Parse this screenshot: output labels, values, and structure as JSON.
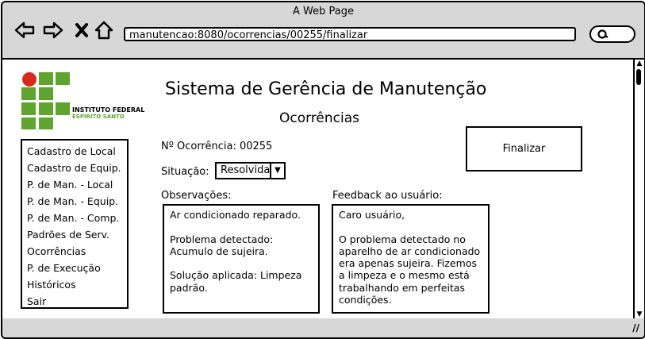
{
  "browser": {
    "title": "A Web Page",
    "url": "manutencao:8080/ocorrencias/00255/finalizar"
  },
  "logo": {
    "line1": "INSTITUTO FEDERAL",
    "line2": "ESPÍRITO SANTO",
    "colors": {
      "green": "#5ea42f",
      "red": "#d9281c"
    }
  },
  "header": {
    "app_title": "Sistema de Gerência de Manutenção",
    "section_title": "Ocorrências"
  },
  "sidebar": {
    "items": [
      {
        "label": "Cadastro de Local"
      },
      {
        "label": "Cadastro de Equip."
      },
      {
        "label": "P. de Man. - Local"
      },
      {
        "label": "P. de Man. - Equip."
      },
      {
        "label": "P. de Man. - Comp."
      },
      {
        "label": "Padrões de Serv."
      },
      {
        "label": "Ocorrências"
      },
      {
        "label": "P. de Execução"
      },
      {
        "label": "Históricos"
      },
      {
        "label": "Sair"
      }
    ]
  },
  "form": {
    "occurrence_label": "Nº Ocorrência: 00255",
    "situation_label": "Situação:",
    "situation_value": "Resolvida",
    "observations_label": "Observações:",
    "observations_text": "Ar condicionado reparado.\n\nProblema detectado: Acumulo de sujeira.\n\nSolução aplicada: Limpeza padrão.",
    "feedback_label": "Feedback ao usuário:",
    "feedback_text": "Caro usuário,\n\nO problema detectado no aparelho de ar condicionado era apenas sujeira. Fizemos a limpeza e o mesmo está trabalhando em perfeitas condições."
  },
  "actions": {
    "finalize_label": "Finalizar"
  }
}
